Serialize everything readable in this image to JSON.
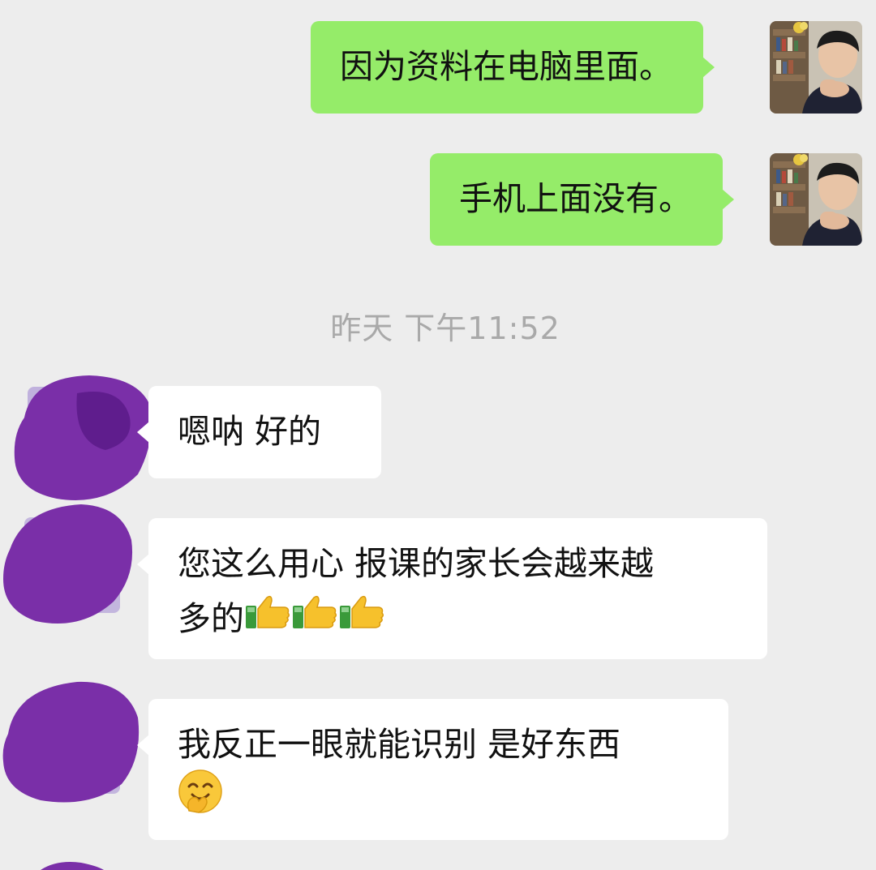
{
  "messages": [
    {
      "sender": "self",
      "text": "因为资料在电脑里面。"
    },
    {
      "sender": "self",
      "text": "手机上面没有。"
    },
    {
      "type": "timestamp",
      "text": "昨天 下午11:52"
    },
    {
      "sender": "other",
      "text": "嗯呐 好的"
    },
    {
      "sender": "other",
      "line1": "您这么用心 报课的家长会越来越",
      "line2": "多的",
      "emojis": [
        "thumbs-up-icon",
        "thumbs-up-icon",
        "thumbs-up-icon"
      ]
    },
    {
      "sender": "other",
      "text": "我反正一眼就能识别 是好东西",
      "emojis": [
        "hugging-face-icon"
      ]
    }
  ],
  "colors": {
    "background": "#ededed",
    "outgoing_bubble": "#95ec69",
    "incoming_bubble": "#ffffff",
    "avatar_redaction": "#7a2fa8",
    "timestamp_text": "#a9a9a9"
  }
}
